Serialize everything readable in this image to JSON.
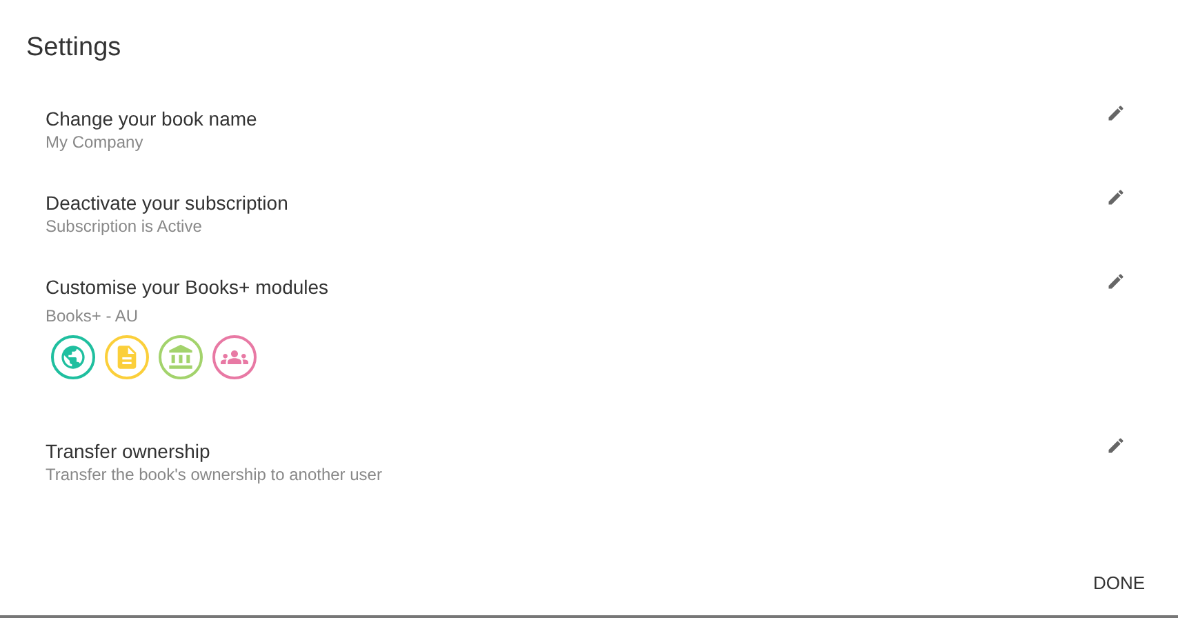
{
  "title": "Settings",
  "settings": [
    {
      "label": "Change your book name",
      "value": "My Company"
    },
    {
      "label": "Deactivate your subscription",
      "value": "Subscription is Active"
    },
    {
      "label": "Customise your Books+ modules",
      "value": "Books+ - AU",
      "modules": [
        {
          "kind": "globe",
          "color": "#1fbf9f"
        },
        {
          "kind": "document",
          "color": "#fbcf3a"
        },
        {
          "kind": "bank",
          "color": "#a3d36c"
        },
        {
          "kind": "people",
          "color": "#e879a4"
        }
      ]
    },
    {
      "label": "Transfer ownership",
      "value": "Transfer the book's ownership to another user"
    }
  ],
  "done_button": "DONE"
}
